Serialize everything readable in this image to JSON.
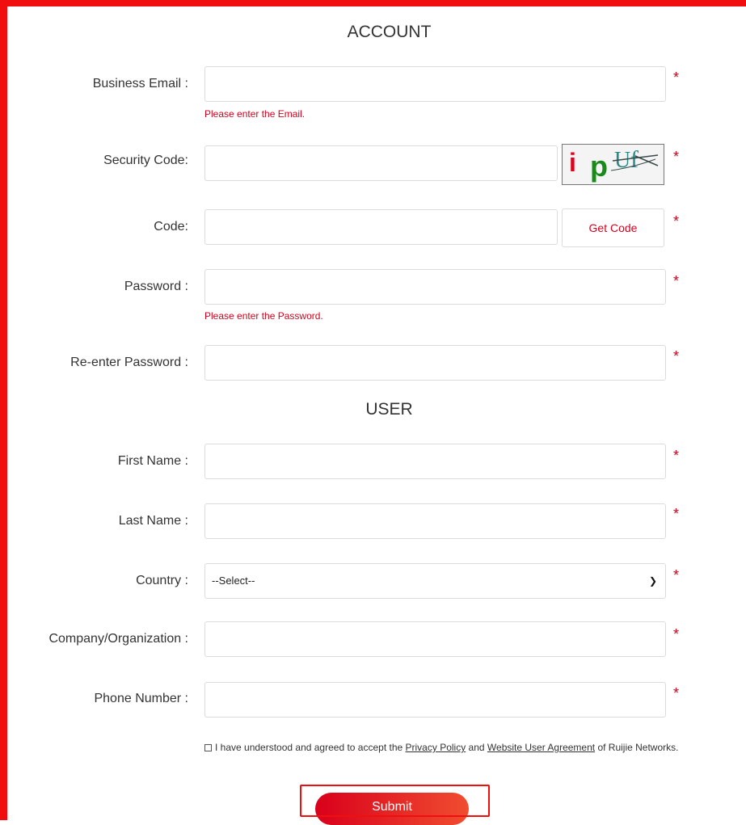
{
  "sections": {
    "account_title": "ACCOUNT",
    "user_title": "USER"
  },
  "fields": {
    "business_email": {
      "label": "Business Email :",
      "value": "",
      "error": "Please enter the Email."
    },
    "security_code": {
      "label": "Security Code:",
      "value": ""
    },
    "code": {
      "label": "Code:",
      "value": "",
      "button": "Get Code"
    },
    "password": {
      "label": "Password :",
      "value": "",
      "error": "Please enter the Password."
    },
    "reenter_password": {
      "label": "Re-enter Password :",
      "value": ""
    },
    "first_name": {
      "label": "First Name :",
      "value": ""
    },
    "last_name": {
      "label": "Last Name :",
      "value": ""
    },
    "country": {
      "label": "Country :",
      "selected": "--Select--"
    },
    "company": {
      "label": "Company/Organization :",
      "value": ""
    },
    "phone": {
      "label": "Phone Number :",
      "value": ""
    }
  },
  "required_marker": "*",
  "captcha": {
    "chars": [
      "i",
      "p",
      "U",
      "f"
    ]
  },
  "agreement": {
    "prefix": "I have understood and agreed to accept the",
    "privacy_link": "Privacy Policy",
    "and": "and",
    "agreement_link": "Website User Agreement",
    "suffix": "of Ruijie Networks.",
    "checked": false
  },
  "submit_label": "Submit",
  "colors": {
    "accent": "#d6001c",
    "frame": "#f00e0e"
  }
}
